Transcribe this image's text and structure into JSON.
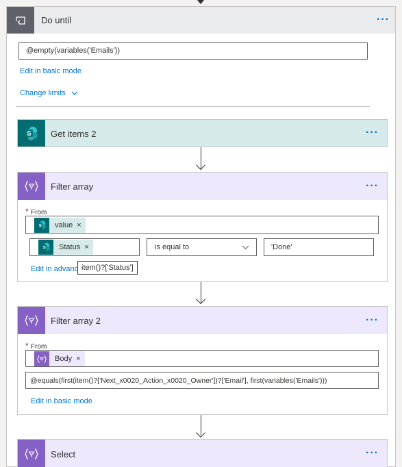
{
  "do_until": {
    "title": "Do until",
    "menu": "···",
    "expression": "@empty(variables('Emails'))",
    "edit_basic": "Edit in basic mode",
    "change_limits": "Change limits"
  },
  "get_items": {
    "title": "Get items 2",
    "menu": "···"
  },
  "filter_array": {
    "title": "Filter array",
    "menu": "···",
    "from_required": "*",
    "from_label": "From",
    "from_token": "value",
    "token_remove": "×",
    "condition_token": "Status",
    "operator": "is equal to",
    "value": "'Done'",
    "edit_advanced": "Edit in advanced mode",
    "edit_advanced_visible": "Edit in advanc",
    "tooltip": "item()?['Status']"
  },
  "filter_array_2": {
    "title": "Filter array 2",
    "menu": "···",
    "from_required": "*",
    "from_label": "From",
    "from_token": "Body",
    "token_remove": "×",
    "expression": "@equals(first(item()?['Next_x0020_Action_x0020_Owner'])?['Email'], first(variables('Emails')))",
    "edit_basic": "Edit in basic mode"
  },
  "select": {
    "title": "Select",
    "menu": "···"
  },
  "colors": {
    "sharepoint": "#036c70",
    "data_operation": "#8661c5",
    "link": "#0078d4",
    "loop": "#5e6169"
  }
}
